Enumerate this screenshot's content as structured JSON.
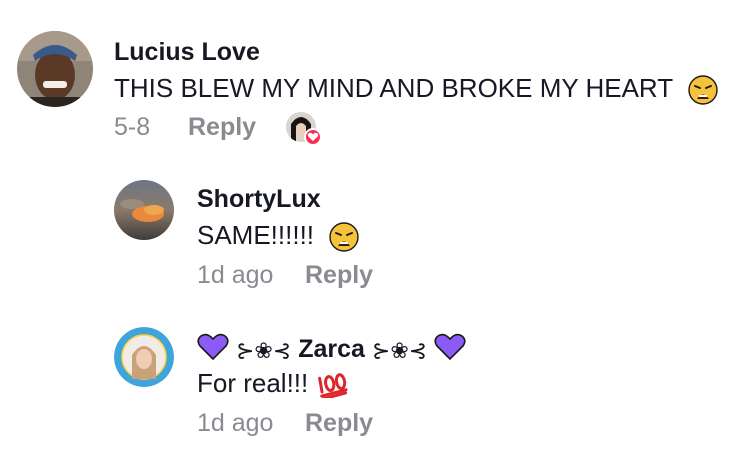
{
  "comments": [
    {
      "username": "Lucius Love",
      "text": "THIS BLEW MY MIND AND BROKE MY HEART",
      "emoji": "weary-face-emoji",
      "date": "5-8",
      "reply_label": "Reply",
      "creator_liked": true
    },
    {
      "username": "ShortyLux",
      "text": "SAME!!!!!!",
      "emoji": "weary-face-emoji",
      "date": "1d ago",
      "reply_label": "Reply"
    },
    {
      "username_prefix": "⊱❀⊰",
      "username": "Zarca",
      "username_suffix": "⊱❀⊰",
      "text": "For real!!!",
      "emoji": "hundred-points-emoji",
      "date": "1d ago",
      "reply_label": "Reply"
    }
  ],
  "colors": {
    "text": "#161823",
    "meta": "#8a8b91",
    "like_badge": "#fe2c55",
    "purple_heart": "#8a5cf5",
    "weary_face": "#f5c33b"
  }
}
